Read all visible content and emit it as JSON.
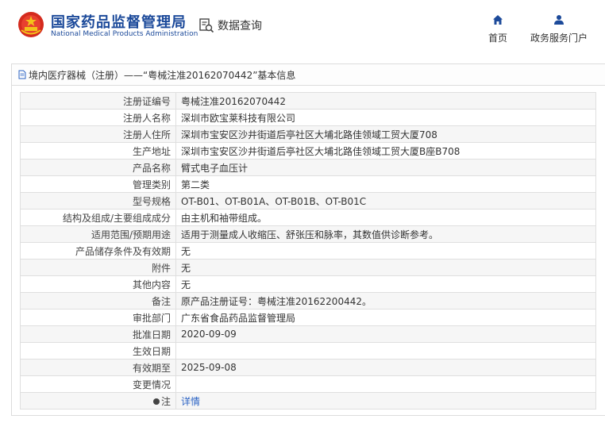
{
  "header": {
    "title_cn": "国家药品监督管理局",
    "title_en": "National Medical Products Administration",
    "query_label": "数据查询",
    "nav": [
      {
        "label": "首页",
        "icon": "home-icon"
      },
      {
        "label": "政务服务门户",
        "icon": "user-icon"
      }
    ]
  },
  "breadcrumb": {
    "text": "境内医疗器械（注册）——“粤械注准20162070442”基本信息"
  },
  "details": [
    {
      "label": "注册证编号",
      "value": "粤械注准20162070442"
    },
    {
      "label": "注册人名称",
      "value": "深圳市欧宝莱科技有限公司"
    },
    {
      "label": "注册人住所",
      "value": "深圳市宝安区沙井街道后亭社区大埔北路佳领域工贸大厦708"
    },
    {
      "label": "生产地址",
      "value": "深圳市宝安区沙井街道后亭社区大埔北路佳领域工贸大厦B座B708"
    },
    {
      "label": "产品名称",
      "value": "臂式电子血压计"
    },
    {
      "label": "管理类别",
      "value": "第二类"
    },
    {
      "label": "型号规格",
      "value": "OT-B01、OT-B01A、OT-B01B、OT-B01C"
    },
    {
      "label": "结构及组成/主要组成成分",
      "value": "由主机和袖带组成。"
    },
    {
      "label": "适用范围/预期用途",
      "value": "适用于测量成人收缩压、舒张压和脉率，其数值供诊断参考。"
    },
    {
      "label": "产品储存条件及有效期",
      "value": "无"
    },
    {
      "label": "附件",
      "value": "无"
    },
    {
      "label": "其他内容",
      "value": "无"
    },
    {
      "label": "备注",
      "value": "原产品注册证号：粤械注准20162200442。"
    },
    {
      "label": "审批部门",
      "value": "广东省食品药品监督管理局"
    },
    {
      "label": "批准日期",
      "value": "2020-09-09"
    },
    {
      "label": "生效日期",
      "value": ""
    },
    {
      "label": "有效期至",
      "value": "2025-09-08"
    },
    {
      "label": "变更情况",
      "value": ""
    }
  ],
  "note_row": {
    "label": "注",
    "link_text": "详情"
  },
  "colors": {
    "brand_blue": "#1c4a9a",
    "link_blue": "#2a62c4",
    "emblem_red": "#d42b1e",
    "emblem_gold": "#f3c21a"
  }
}
